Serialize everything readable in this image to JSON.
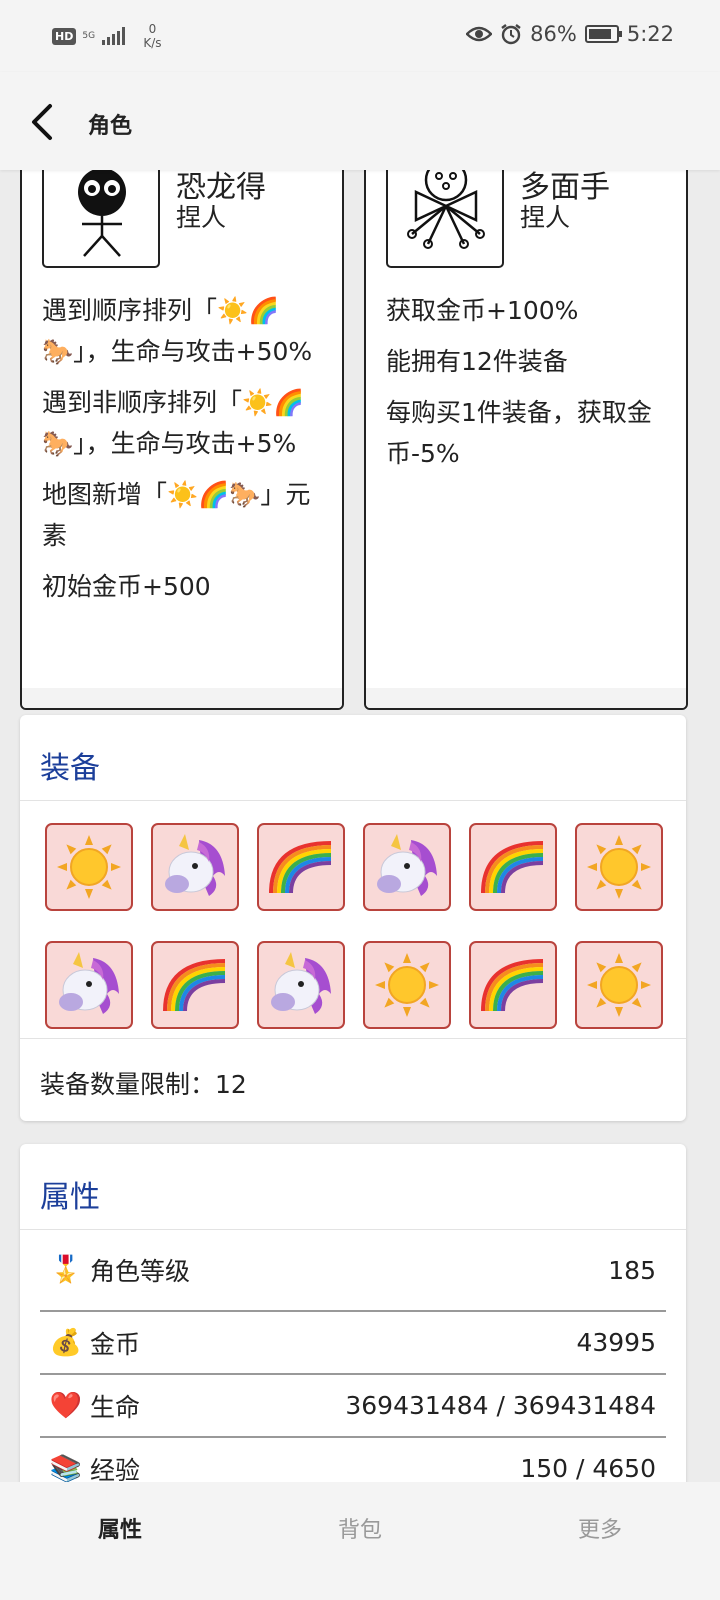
{
  "status_bar": {
    "hd": "HD",
    "network": "5G",
    "speed_value": "0",
    "speed_unit": "K/s",
    "battery": "86%",
    "time": "5:22"
  },
  "header": {
    "title": "角色"
  },
  "characters": [
    {
      "name": "恐龙得",
      "role": "捏人",
      "descriptions": [
        "遇到顺序排列「☀️🌈🐎」，生命与攻击+50%",
        "遇到非顺序排列「☀️🌈🐎」，生命与攻击+5%",
        "地图新增「☀️🌈🐎」元素",
        "初始金币+500"
      ]
    },
    {
      "name": "多面手",
      "role": "捏人",
      "descriptions": [
        "获取金币+100%",
        "能拥有12件装备",
        "每购买1件装备，获取金币-5%"
      ]
    }
  ],
  "equipment": {
    "title": "装备",
    "slots": [
      "sun-icon",
      "unicorn-icon",
      "rainbow-icon",
      "unicorn-icon",
      "rainbow-icon",
      "sun-icon",
      "unicorn-icon",
      "rainbow-icon",
      "unicorn-icon",
      "sun-icon",
      "rainbow-icon",
      "sun-icon"
    ],
    "limit_text": "装备数量限制：12"
  },
  "attributes": {
    "title": "属性",
    "rows": [
      {
        "icon": "🎖️",
        "label": "角色等级",
        "value": "185"
      },
      {
        "icon": "💰",
        "label": "金币",
        "value": "43995"
      },
      {
        "icon": "❤️",
        "label": "生命",
        "value": "369431484 / 369431484"
      },
      {
        "icon": "📚",
        "label": "经验",
        "value": "150 / 4650"
      }
    ]
  },
  "bottom_nav": {
    "items": [
      "属性",
      "背包",
      "更多"
    ],
    "active": "属性"
  },
  "colors": {
    "accent": "#1c3f9a",
    "slot_bg": "#f9d9d7",
    "slot_border": "#b9433d"
  }
}
